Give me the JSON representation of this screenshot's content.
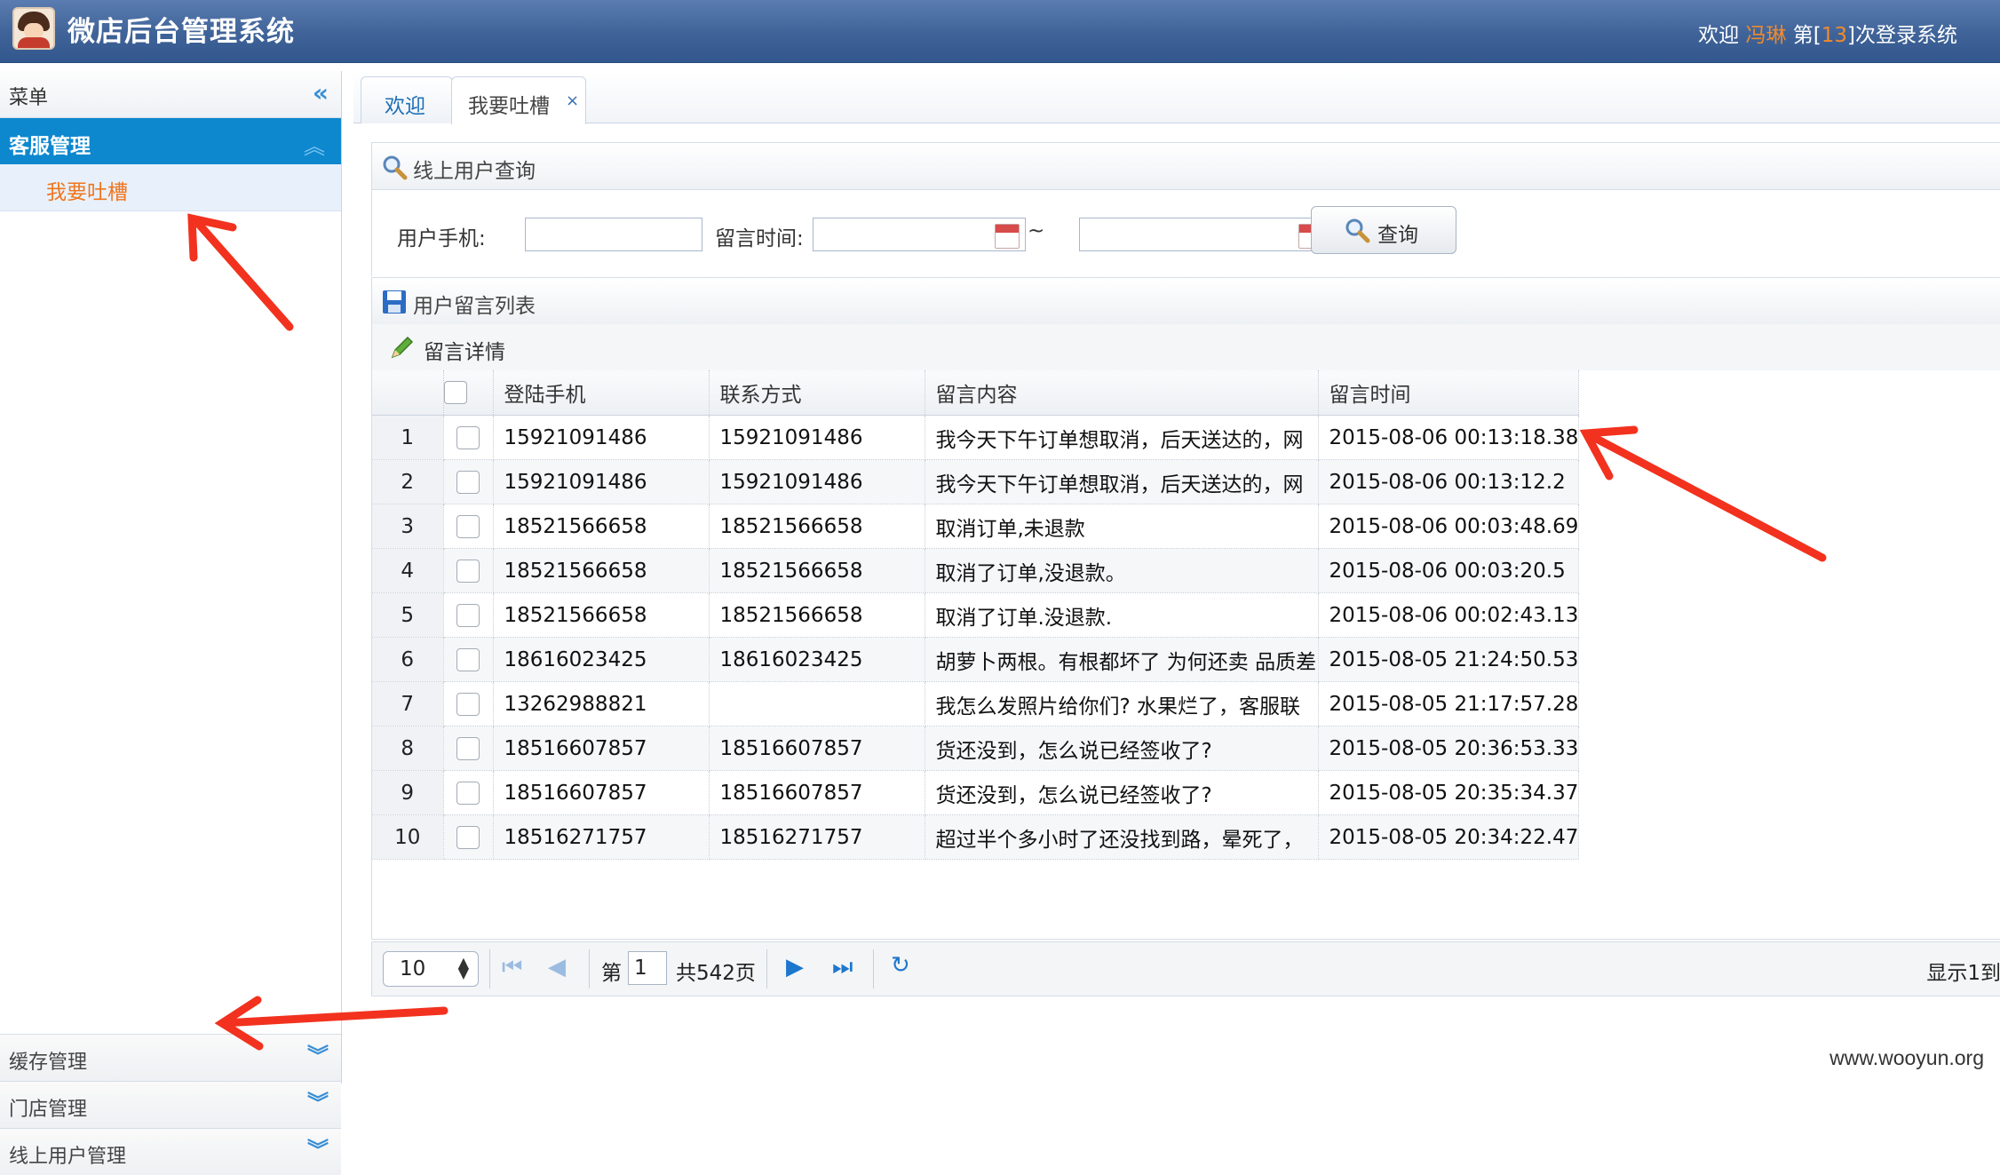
{
  "header": {
    "title": "微店后台管理系统",
    "welcome_prefix": "欢迎",
    "user_name": "冯琳",
    "login_prefix": "第[",
    "login_count": "13",
    "login_suffix": "]次登录系统"
  },
  "sidebar": {
    "menu_label": "菜单",
    "active_group": "客服管理",
    "active_item": "我要吐槽",
    "bottom_groups": [
      "缓存管理",
      "门店管理",
      "线上用户管理"
    ]
  },
  "tabs": [
    {
      "label": "欢迎"
    },
    {
      "label": "我要吐槽",
      "close": "×"
    }
  ],
  "search_panel": {
    "title": "线上用户查询",
    "phone_label": "用户手机:",
    "phone_value": "",
    "time_label": "留言时间:",
    "time_from": "",
    "time_sep": "~",
    "time_to": "",
    "query_button": "查询"
  },
  "list_panel": {
    "title": "用户留言列表",
    "detail_button": "留言详情"
  },
  "table": {
    "columns": [
      "登陆手机",
      "联系方式",
      "留言内容",
      "留言时间"
    ],
    "rows": [
      {
        "n": "1",
        "phone": "15921091486",
        "contact": "15921091486",
        "content": "我今天下午订单想取消，后天送达的，网",
        "time": "2015-08-06 00:13:18.38"
      },
      {
        "n": "2",
        "phone": "15921091486",
        "contact": "15921091486",
        "content": "我今天下午订单想取消，后天送达的，网",
        "time": "2015-08-06 00:13:12.2"
      },
      {
        "n": "3",
        "phone": "18521566658",
        "contact": "18521566658",
        "content": "取消订单,未退款",
        "time": "2015-08-06 00:03:48.69"
      },
      {
        "n": "4",
        "phone": "18521566658",
        "contact": "18521566658",
        "content": "取消了订单,没退款。",
        "time": "2015-08-06 00:03:20.5"
      },
      {
        "n": "5",
        "phone": "18521566658",
        "contact": "18521566658",
        "content": "取消了订单.没退款.",
        "time": "2015-08-06 00:02:43.13"
      },
      {
        "n": "6",
        "phone": "18616023425",
        "contact": "18616023425",
        "content": "胡萝卜两根。有根都坏了 为何还卖 品质差",
        "time": "2015-08-05 21:24:50.53"
      },
      {
        "n": "7",
        "phone": "13262988821",
        "contact": "",
        "content": "我怎么发照片给你们? 水果烂了，客服联",
        "time": "2015-08-05 21:17:57.28"
      },
      {
        "n": "8",
        "phone": "18516607857",
        "contact": "18516607857",
        "content": "货还没到，怎么说已经签收了?",
        "time": "2015-08-05 20:36:53.33"
      },
      {
        "n": "9",
        "phone": "18516607857",
        "contact": "18516607857",
        "content": "货还没到，怎么说已经签收了?",
        "time": "2015-08-05 20:35:34.37"
      },
      {
        "n": "10",
        "phone": "18516271757",
        "contact": "18516271757",
        "content": "超过半个多小时了还没找到路，晕死了，",
        "time": "2015-08-05 20:34:22.47"
      }
    ]
  },
  "pager": {
    "page_size": "10",
    "page_prefix": "第",
    "page_value": "1",
    "total_pages": "共542页",
    "display_info": "显示1到"
  },
  "footer": {
    "watermark": "www.wooyun.org"
  },
  "colors": {
    "accent": "#0d88cf",
    "highlight": "#f0751e",
    "annotation_arrow": "#f2321e"
  }
}
